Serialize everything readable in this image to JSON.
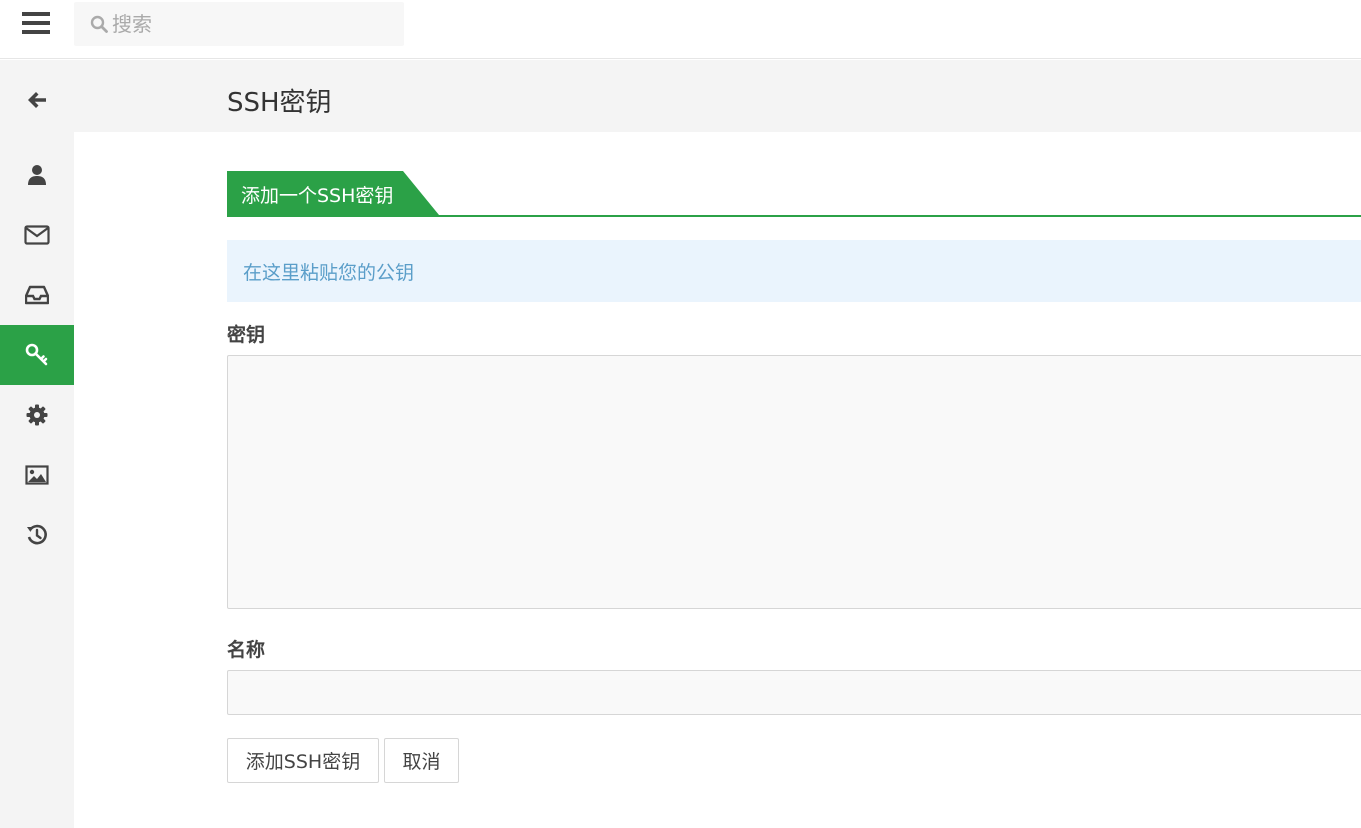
{
  "header": {
    "search_placeholder": "搜索"
  },
  "sidebar": {
    "items": [
      {
        "name": "back",
        "icon": "arrow-left-icon"
      },
      {
        "name": "profile",
        "icon": "user-icon"
      },
      {
        "name": "email",
        "icon": "envelope-icon"
      },
      {
        "name": "inbox",
        "icon": "inbox-icon"
      },
      {
        "name": "ssh-keys",
        "icon": "key-icon",
        "active": true
      },
      {
        "name": "settings",
        "icon": "gear-icon"
      },
      {
        "name": "images",
        "icon": "image-icon"
      },
      {
        "name": "history",
        "icon": "history-icon"
      }
    ]
  },
  "page": {
    "title": "SSH密钥",
    "tab_label": "添加一个SSH密钥",
    "info_text": "在这里粘贴您的公钥",
    "key_label": "密钥",
    "key_value": "",
    "name_label": "名称",
    "name_value": "",
    "submit_label": "添加SSH密钥",
    "cancel_label": "取消"
  },
  "colors": {
    "accent": "#2ba147",
    "info_bg": "#eaf4fd",
    "info_text": "#5b9ec9",
    "sidebar_bg": "#f4f4f4"
  }
}
